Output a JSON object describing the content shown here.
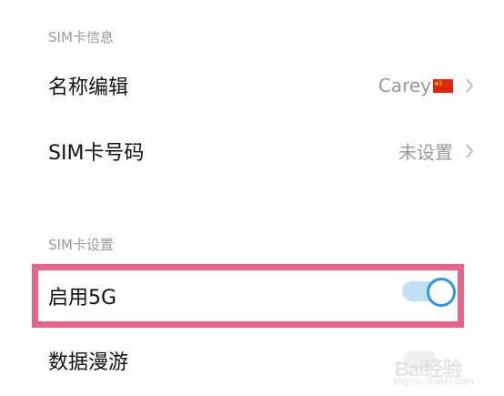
{
  "sim_info": {
    "header": "SIM卡信息",
    "name_edit": {
      "label": "名称编辑",
      "value": "Carey"
    },
    "sim_number": {
      "label": "SIM卡号码",
      "value": "未设置"
    }
  },
  "sim_settings": {
    "header": "SIM卡设置",
    "enable_5g": {
      "label": "启用5G",
      "enabled": true
    },
    "data_roaming": {
      "label": "数据漫游"
    }
  },
  "watermark": {
    "brand": "Bai经验",
    "url": "jingyan.baidu.com"
  },
  "colors": {
    "highlight": "#e8628a",
    "toggle_on": "#2f96e8",
    "toggle_track": "#bfe0f7"
  }
}
